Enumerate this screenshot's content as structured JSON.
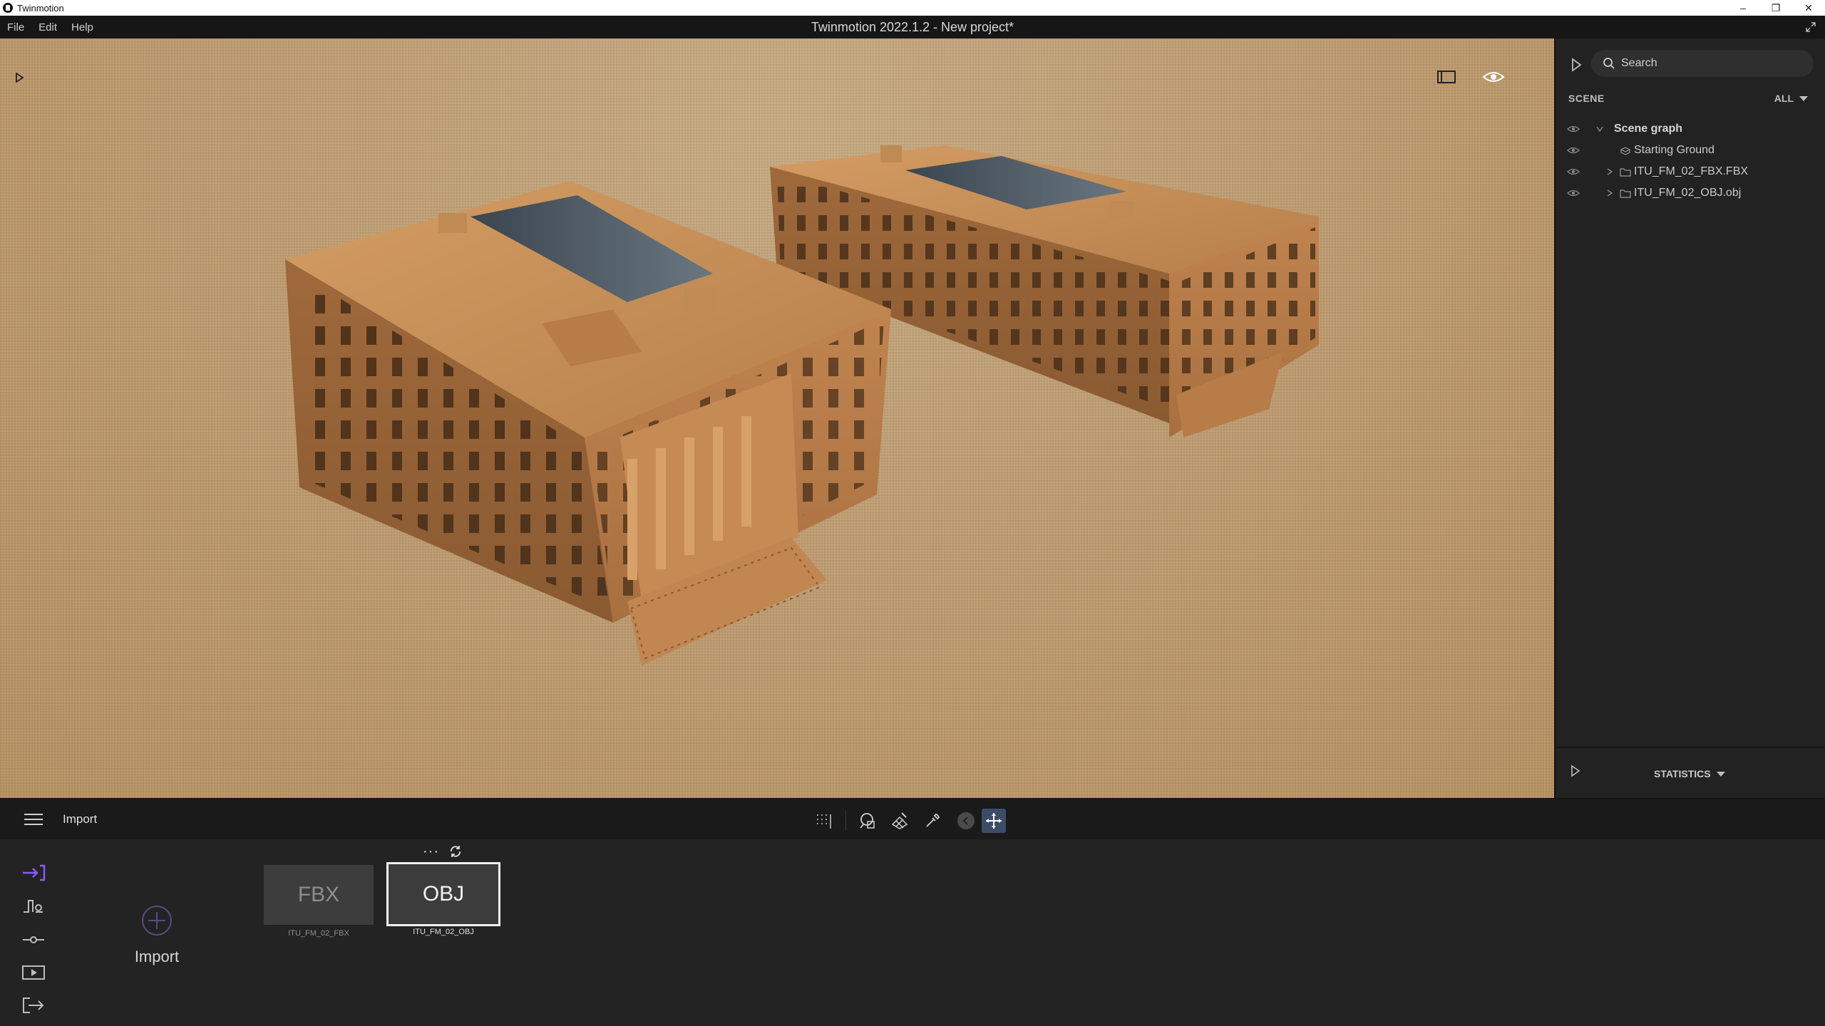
{
  "os_window": {
    "title": "Twinmotion",
    "controls": {
      "minimize": "–",
      "restore": "❐",
      "close": "✕"
    }
  },
  "menu": {
    "items": [
      "File",
      "Edit",
      "Help"
    ],
    "document_title": "Twinmotion 2022.1.2 - New project*"
  },
  "viewport": {
    "icons": [
      "expand-panel-icon",
      "frame-icon",
      "eye-icon"
    ]
  },
  "scene_panel": {
    "search_placeholder": "Search",
    "header": "SCENE",
    "filter": "ALL",
    "tree": [
      {
        "label": "Scene graph",
        "type": "root"
      },
      {
        "label": "Starting Ground",
        "type": "ground"
      },
      {
        "label": "ITU_FM_02_FBX.FBX",
        "type": "folder"
      },
      {
        "label": "ITU_FM_02_OBJ.obj",
        "type": "folder"
      }
    ],
    "statistics_label": "STATISTICS"
  },
  "toolbar": {
    "section_title": "Import"
  },
  "import_panel": {
    "import_label": "Import",
    "assets": [
      {
        "thumb_label": "FBX",
        "name": "ITU_FM_02_FBX",
        "selected": false
      },
      {
        "thumb_label": "OBJ",
        "name": "ITU_FM_02_OBJ",
        "selected": true
      }
    ],
    "more_label": "···"
  },
  "colors": {
    "ground": "#c09e73",
    "building": "#c8905a",
    "accent": "#8b5cf6",
    "active_tool": "#3b4d66"
  }
}
